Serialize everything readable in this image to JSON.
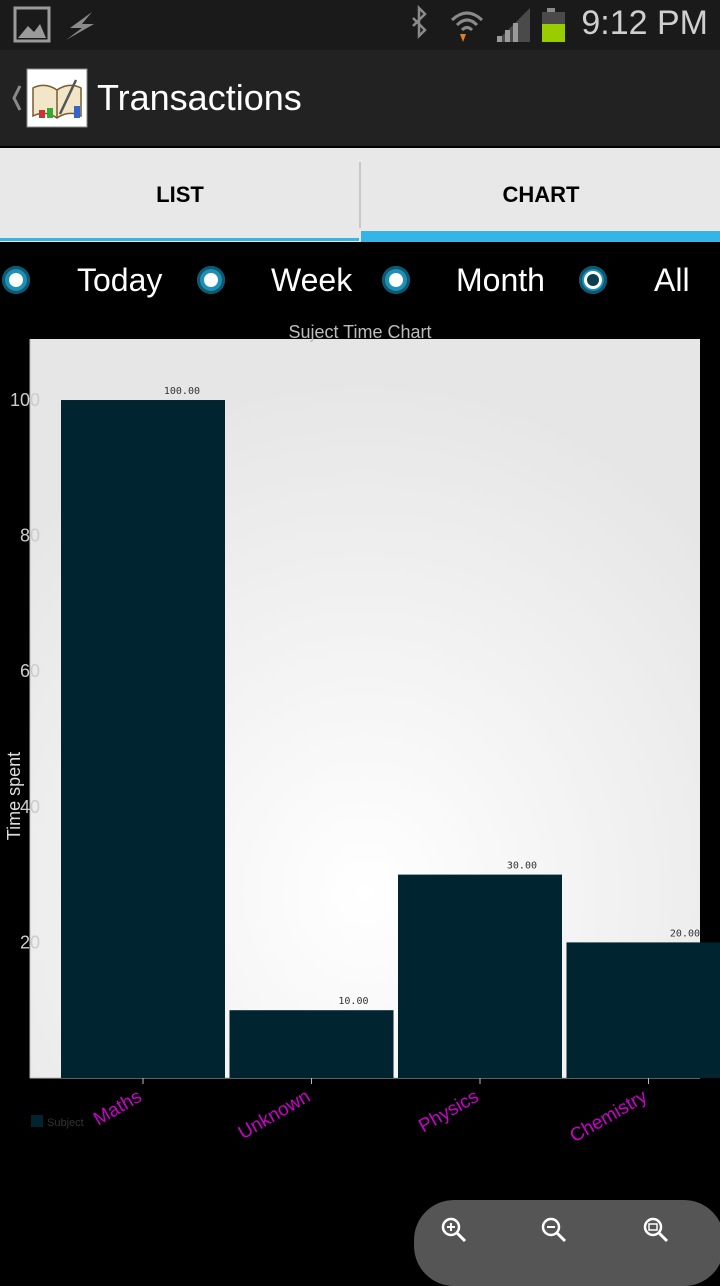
{
  "status_bar": {
    "time": "9:12 PM"
  },
  "action_bar": {
    "title": "Transactions"
  },
  "tabs": [
    {
      "label": "LIST",
      "selected": false
    },
    {
      "label": "CHART",
      "selected": true
    }
  ],
  "filters": [
    {
      "label": "Today",
      "selected": false
    },
    {
      "label": "Week",
      "selected": false
    },
    {
      "label": "Month",
      "selected": false
    },
    {
      "label": "All",
      "selected": true
    }
  ],
  "colors": {
    "accent": "#33b5e5",
    "bar": "#002530",
    "xlabel": "#cc00cc",
    "plot_bg": "#efefef"
  },
  "chart_data": {
    "type": "bar",
    "title": "Suject Time Chart",
    "ylabel": "Time spent",
    "categories": [
      "Maths",
      "Unknown",
      "Physics",
      "Chemistry"
    ],
    "series": [
      {
        "name": "Subject",
        "values": [
          100,
          10,
          30,
          20
        ]
      }
    ],
    "value_labels": [
      "100.00",
      "10.00",
      "30.00",
      "20.00"
    ],
    "yticks": [
      "100",
      "80",
      "60",
      "40",
      "20"
    ],
    "ylim": [
      0,
      109
    ]
  },
  "zoom_controls": [
    "zoom-in-icon",
    "zoom-out-icon",
    "zoom-reset-icon"
  ]
}
